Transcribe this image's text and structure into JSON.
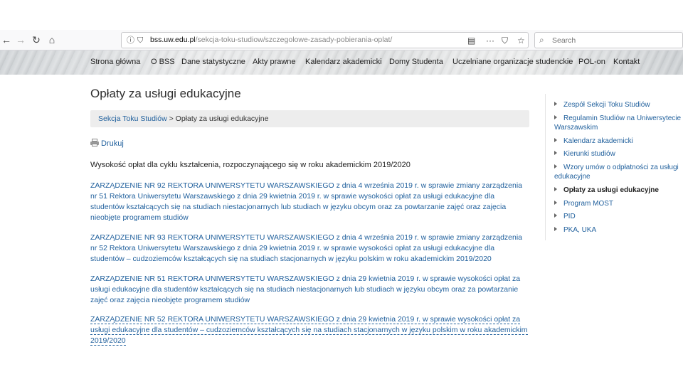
{
  "browser": {
    "url_host": "bss.uw.edu.pl",
    "url_path": "/sekcja-toku-studiow/szczegolowe-zasady-pobierania-oplat/",
    "search_placeholder": "Search"
  },
  "site_nav": {
    "items": [
      "Strona główna",
      "O BSS",
      "Dane statystyczne",
      "Akty prawne",
      "Kalendarz akademicki",
      "Domy Studenta",
      "Uczelniane organizacje studenckie",
      "POL-on",
      "Kontakt"
    ]
  },
  "page": {
    "title": "Opłaty za usługi edukacyjne",
    "breadcrumb_parent": "Sekcja Toku Studiów",
    "breadcrumb_sep": " > ",
    "breadcrumb_current": "Opłaty za usługi edukacyjne",
    "print_label": "Drukuj",
    "intro": "Wysokość opłat dla cyklu kształcenia, rozpoczynającego się w roku akademickim 2019/2020",
    "regulations": [
      "ZARZĄDZENIE NR 92 REKTORA UNIWERSYTETU WARSZAWSKIEGO z dnia 4 września 2019 r. w sprawie zmiany zarządzenia nr 51 Rektora Uniwersytetu Warszawskiego z dnia 29 kwietnia 2019 r. w sprawie wysokości opłat za usługi edukacyjne dla studentów kształcących się na studiach niestacjonarnych lub studiach w języku obcym oraz za powtarzanie zajęć oraz zajęcia nieobjęte programem studiów",
      "ZARZĄDZENIE NR 93 REKTORA UNIWERSYTETU WARSZAWSKIEGO z dnia 4 września 2019 r. w sprawie zmiany zarządzenia nr 52 Rektora Uniwersytetu Warszawskiego z dnia 29 kwietnia 2019 r. w sprawie wysokości opłat za usługi edukacyjne dla studentów – cudzoziemców kształcących się na studiach stacjonarnych w języku polskim w roku akademickim 2019/2020",
      "ZARZĄDZENIE NR 51 REKTORA UNIWERSYTETU WARSZAWSKIEGO z dnia 29 kwietnia 2019 r. w sprawie wysokości opłat za usługi edukacyjne dla studentów kształcących się na studiach niestacjonarnych lub studiach w języku obcym oraz za powtarzanie zajęć oraz zajęcia nieobjęte programem studiów",
      "ZARZĄDZENIE NR 52 REKTORA UNIWERSYTETU WARSZAWSKIEGO z dnia 29 kwietnia 2019 r. w sprawie wysokości opłat za usługi edukacyjne dla studentów – cudzoziemców kształcących się na studiach stacjonarnych w języku polskim w roku akademickim 2019/2020"
    ]
  },
  "sidebar": {
    "items": [
      "Zespół Sekcji Toku Studiów",
      "Regulamin Studiów na Uniwersytecie Warszawskim",
      "Kalendarz akademicki",
      "Kierunki studiów",
      "Wzory umów o odpłatności za usługi edukacyjne",
      "Opłaty za usługi edukacyjne",
      "Program MOST",
      "PID",
      "PKA, UKA"
    ],
    "active_index": 5
  },
  "colors": {
    "link": "#1f5f9c",
    "breadcrumb_bg": "#ededed",
    "text": "#222222"
  }
}
